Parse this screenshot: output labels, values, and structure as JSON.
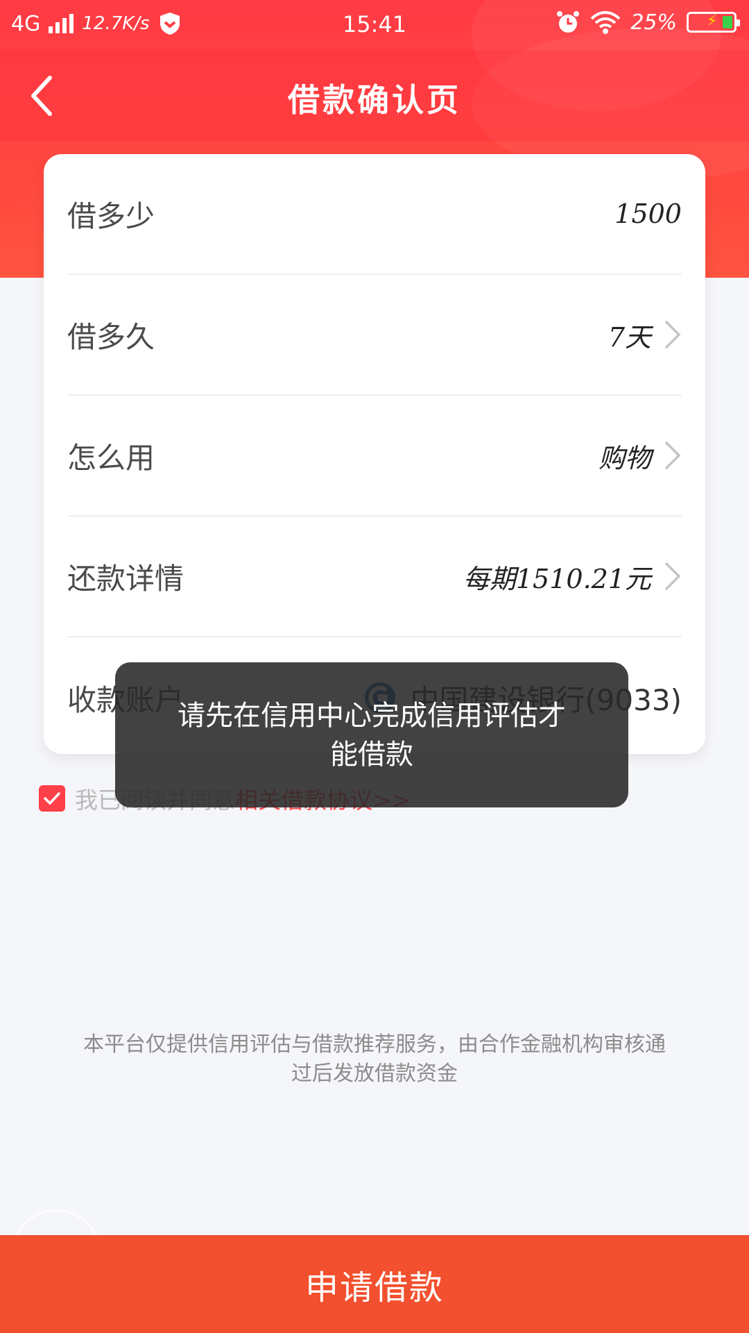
{
  "status_bar": {
    "network": "4G",
    "speed": "12.7K/s",
    "time": "15:41",
    "battery": "25%"
  },
  "nav": {
    "title": "借款确认页"
  },
  "form": {
    "rows": [
      {
        "label": "借多少",
        "value": "1500"
      },
      {
        "label": "借多久",
        "value": "7天"
      },
      {
        "label": "怎么用",
        "value": "购物"
      },
      {
        "label": "还款详情",
        "value": "每期1510.21元"
      },
      {
        "label": "收款账户",
        "value": "中国建设银行(9033)"
      }
    ]
  },
  "agreement": {
    "prefix": "我已阅读并同意",
    "link": "相关借款协议>>",
    "checked": true
  },
  "disclaimer": "本平台仅提供信用评估与借款推荐服务，由合作金融机构审核通过后发放借款资金",
  "toast": {
    "message": "请先在信用中心完成信用评估才能借款"
  },
  "apply_button": "申请借款",
  "colors": {
    "brand_red": "#ff3a44",
    "button_orange": "#f2502e",
    "checkbox_red": "#ff4049"
  }
}
